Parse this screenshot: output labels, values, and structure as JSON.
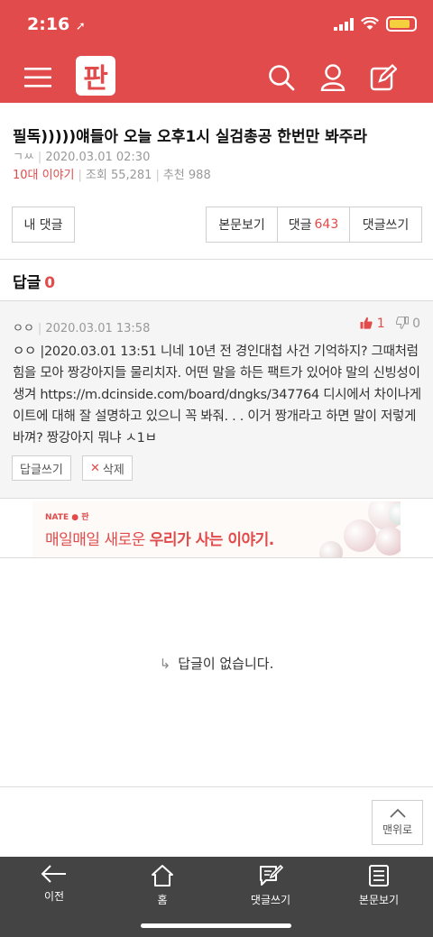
{
  "status": {
    "time": "2:16"
  },
  "header": {
    "logo_text": "판"
  },
  "post": {
    "title": "필독)))))얘들아 오늘 오후1시 실검총공 한번만 봐주라",
    "author": "ㄱㅆ",
    "date": "2020.03.01 02:30",
    "category": "10대 이야기",
    "views": "조회 55,281",
    "recommends": "추천 988"
  },
  "buttons": {
    "my_comments": "내 댓글",
    "view_post": "본문보기",
    "comments_label": "댓글",
    "comments_count": "643",
    "write_comment": "댓글쓰기"
  },
  "replies": {
    "label": "답글",
    "count": "0"
  },
  "comment": {
    "author": "ㅇㅇ",
    "date": "2020.03.01 13:58",
    "up": "1",
    "down": "0",
    "body": "ㅇㅇ |2020.03.01 13:51 니네 10년 전 경인대첩 사건 기억하지? 그때처럼 힘을 모아 짱강아지들 물리치자. 어떤 말을 하든 팩트가 있어야 말의 신빙성이 생겨 https://m.dcinside.com/board/dngks/347764 디시에서 차이나게이트에 대해 잘 설명하고 있으니 꼭 봐줘. . . 이거 짱개라고 하면 말이 저렇게 바껴? 짱강아지 뭐냐 ㅅ1ㅂ",
    "reply_button": "답글쓰기",
    "delete_button": "삭제"
  },
  "ad": {
    "brand": "NATE ● 판",
    "text_plain": "매일매일 새로운 ",
    "text_bold": "우리가 사는 이야기."
  },
  "empty_message": "답글이 없습니다.",
  "top_button": "맨위로",
  "tabbar": [
    {
      "label": "이전",
      "icon": "back-arrow-icon"
    },
    {
      "label": "홈",
      "icon": "home-icon"
    },
    {
      "label": "댓글쓰기",
      "icon": "write-comment-icon"
    },
    {
      "label": "본문보기",
      "icon": "document-icon"
    }
  ],
  "colors": {
    "brand": "#e14b4b",
    "tabbar": "#444444"
  }
}
